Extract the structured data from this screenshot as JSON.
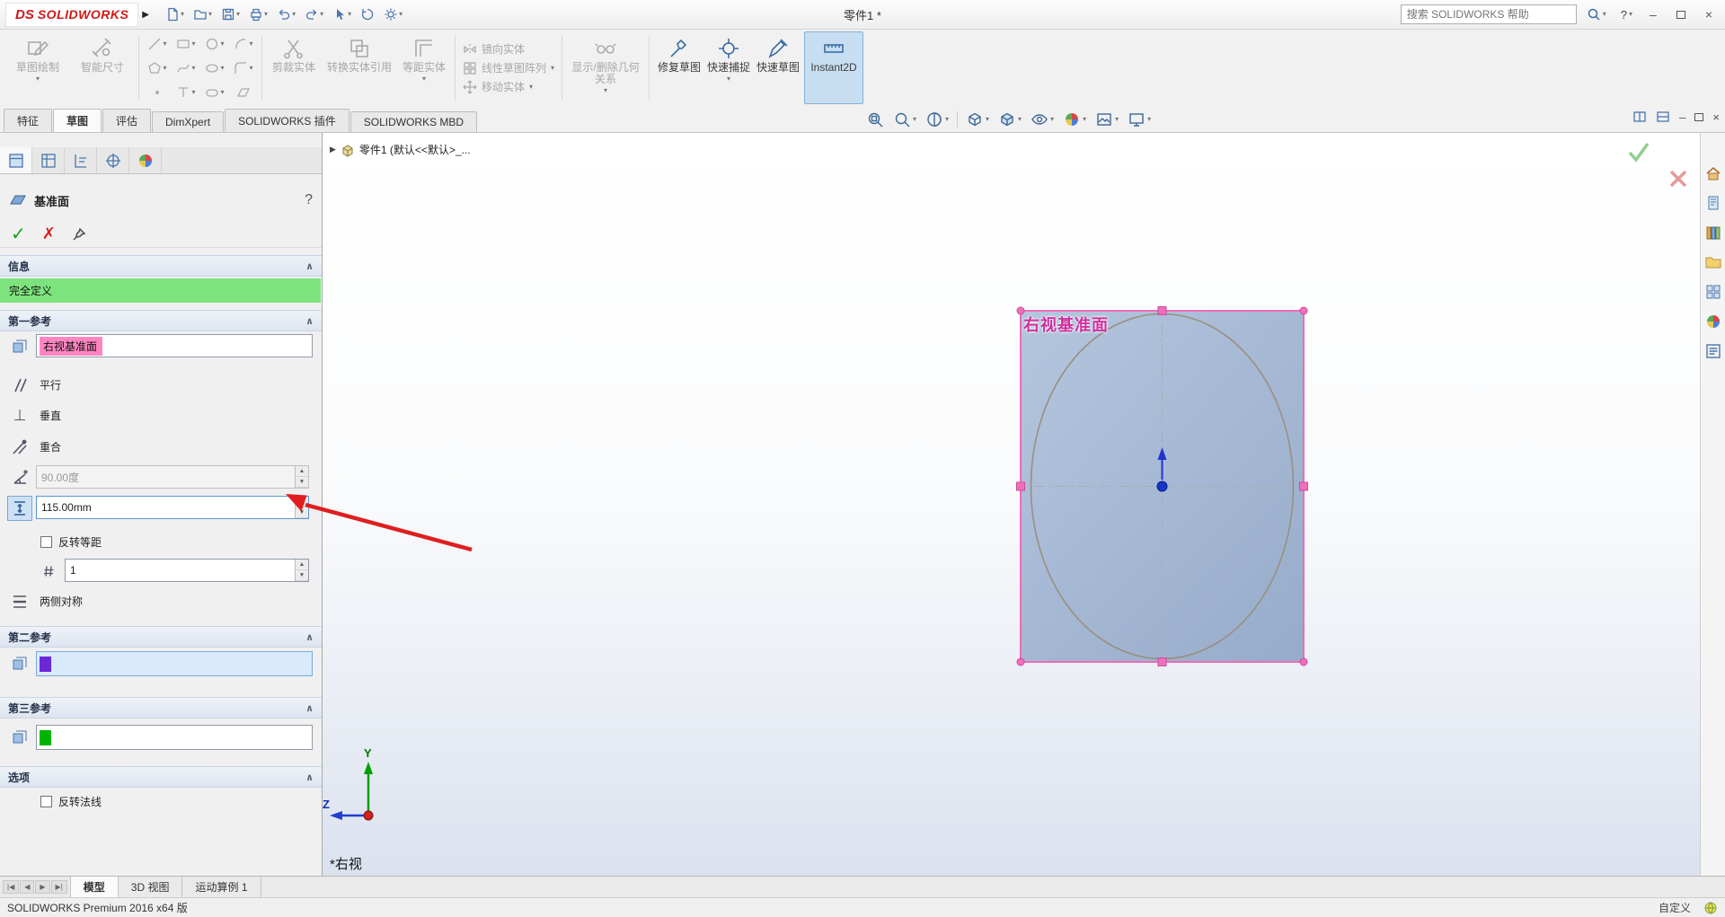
{
  "titlebar": {
    "logo_ds": "DS",
    "logo_text": "SOLIDWORKS",
    "title": "零件1 *",
    "search_placeholder": "搜索 SOLIDWORKS 帮助",
    "help_label": "?"
  },
  "command_tabs": [
    {
      "label": "特征"
    },
    {
      "label": "草图"
    },
    {
      "label": "评估"
    },
    {
      "label": "DimXpert"
    },
    {
      "label": "SOLIDWORKS 插件"
    },
    {
      "label": "SOLIDWORKS MBD"
    }
  ],
  "ribbon": {
    "sketch": "草图绘制",
    "smart_dimension": "智能尺寸",
    "trim_entities": "剪裁实体",
    "convert_entities": "转换实体引用",
    "offset_entities": "等距实体",
    "mirror_entities": "镜向实体",
    "linear_sketch_pattern": "线性草图阵列",
    "move_entities": "移动实体",
    "display_delete_relations": "显示/删除几何关系",
    "repair_sketch": "修复草图",
    "quick_snaps": "快速捕捉",
    "rapid_sketch": "快速草图",
    "instant2d": "Instant2D"
  },
  "property_manager": {
    "title": "基准面",
    "help": "?",
    "sections": {
      "message": "信息",
      "first_reference": "第一参考",
      "second_reference": "第二参考",
      "third_reference": "第三参考",
      "options": "选项"
    },
    "status_message": "完全定义",
    "first_reference": {
      "selection": "右视基准面",
      "parallel": "平行",
      "perpendicular": "垂直",
      "coincident": "重合",
      "angle_value": "90.00度",
      "distance_value": "115.00mm",
      "flip_offset": "反转等距",
      "instances": "1",
      "mid_plane": "两侧对称"
    },
    "options": {
      "flip_normal": "反转法线"
    }
  },
  "viewport": {
    "feature_tree_root": "零件1 (默认<<默认>_...",
    "plane_label": "右视基准面",
    "view_label": "*右视",
    "triad": {
      "y": "Y",
      "z": "Z"
    }
  },
  "bottom_tabs": [
    {
      "label": "模型"
    },
    {
      "label": "3D 视图"
    },
    {
      "label": "运动算例 1"
    }
  ],
  "statusbar": {
    "left": "SOLIDWORKS Premium 2016 x64 版",
    "custom": "自定义"
  },
  "colors": {
    "selection_pink": "#ff85c2",
    "plane_border": "#ee6cb8",
    "plane_fill": "#9cb1d0",
    "fully_defined_green": "#7de37d",
    "second_ref_purple": "#6a28d9",
    "third_ref_green": "#00b400",
    "annotation_red": "#df1f1f",
    "instant2d_active_blue": "#c7def2"
  }
}
